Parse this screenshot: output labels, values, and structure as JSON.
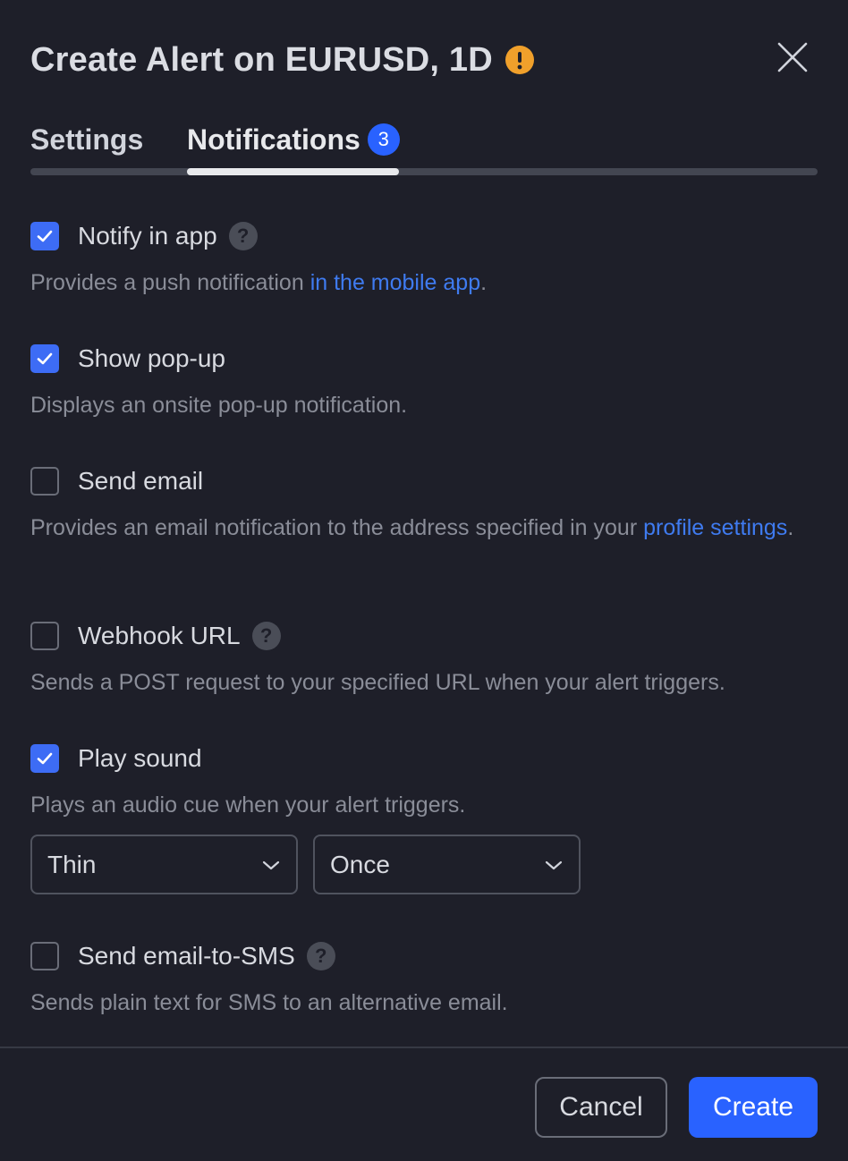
{
  "dialog": {
    "title": "Create Alert on EURUSD, 1D",
    "warning_icon": "exclamation-icon",
    "close_icon": "close-icon"
  },
  "tabs": [
    {
      "label": "Settings",
      "active": false
    },
    {
      "label": "Notifications",
      "active": true,
      "badge": "3"
    }
  ],
  "options": {
    "notify_in_app": {
      "label": "Notify in app",
      "checked": true,
      "has_help": true,
      "desc_before": "Provides a push notification ",
      "desc_link": "in the mobile app",
      "desc_after": "."
    },
    "show_popup": {
      "label": "Show pop-up",
      "checked": true,
      "desc": "Displays an onsite pop-up notification."
    },
    "send_email": {
      "label": "Send email",
      "checked": false,
      "desc_before": "Provides an email notification to the address specified in your ",
      "desc_link": "profile settings",
      "desc_after": "."
    },
    "webhook_url": {
      "label": "Webhook URL",
      "checked": false,
      "has_help": true,
      "desc": "Sends a POST request to your specified URL when your alert triggers."
    },
    "play_sound": {
      "label": "Play sound",
      "checked": true,
      "desc": "Plays an audio cue when your alert triggers.",
      "sound_select": "Thin",
      "repeat_select": "Once"
    },
    "email_to_sms": {
      "label": "Send email-to-SMS",
      "checked": false,
      "has_help": true,
      "desc": "Sends plain text for SMS to an alternative email."
    }
  },
  "footer": {
    "cancel_label": "Cancel",
    "create_label": "Create"
  },
  "colors": {
    "background": "#1e1f29",
    "accent": "#2962ff",
    "link": "#3f7bf0",
    "warning": "#f0a02b"
  }
}
